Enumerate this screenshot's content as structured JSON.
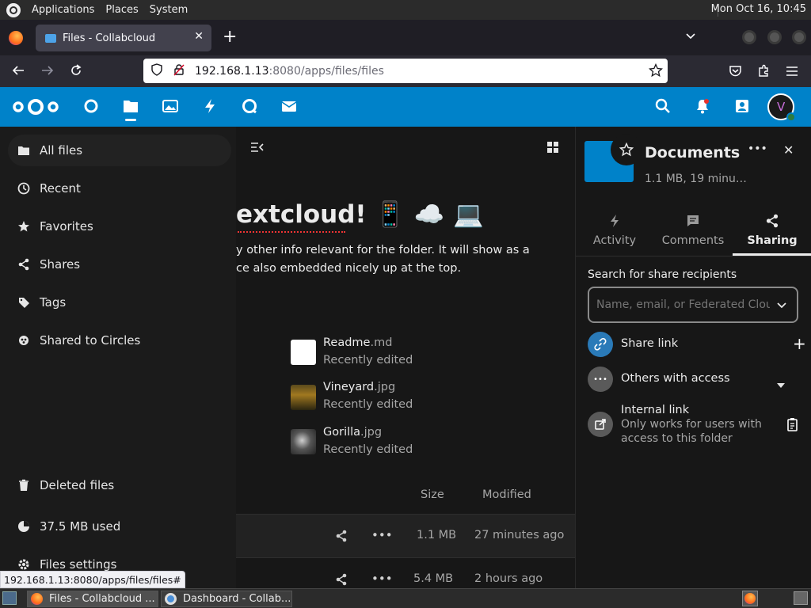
{
  "system": {
    "menu": [
      "Applications",
      "Places",
      "System"
    ],
    "clock": "Mon Oct 16, 10:45"
  },
  "browser": {
    "tab_title": "Files - Collabcloud",
    "url_host": "192.168.1.13",
    "url_rest": ":8080/apps/files/files",
    "status_url": "192.168.1.13:8080/apps/files/files#"
  },
  "nav": {
    "items": [
      "All files",
      "Recent",
      "Favorites",
      "Shares",
      "Tags",
      "Shared to Circles"
    ],
    "deleted": "Deleted files",
    "quota": "37.5 MB used",
    "settings": "Files settings"
  },
  "main": {
    "heading": "extcloud! 📱 ☁️ 💻",
    "para1": "y other info relevant for the folder. It will show as a",
    "para2": "ce also embedded nicely up at the top.",
    "recent": [
      {
        "name": "Readme",
        "ext": ".md",
        "sub": "Recently edited"
      },
      {
        "name": "Vineyard",
        "ext": ".jpg",
        "sub": "Recently edited"
      },
      {
        "name": "Gorilla",
        "ext": ".jpg",
        "sub": "Recently edited"
      }
    ],
    "col_size": "Size",
    "col_modified": "Modified",
    "rows": [
      {
        "size": "1.1 MB",
        "modified": "27 minutes ago"
      },
      {
        "size": "5.4 MB",
        "modified": "2 hours ago"
      }
    ]
  },
  "sidebar": {
    "title": "Documents",
    "subtitle": "1.1 MB, 19 minu…",
    "tabs": [
      "Activity",
      "Comments",
      "Sharing"
    ],
    "search_label": "Search for share recipients",
    "search_placeholder": "Name, email, or Federated Cloud ID …",
    "share_link": "Share link",
    "others_access": "Others with access",
    "internal_link": "Internal link",
    "internal_desc1": "Only works for users with",
    "internal_desc2": "access to this folder"
  },
  "taskbar": {
    "task1": "Files - Collabcloud ...",
    "task2": "Dashboard - Collab..."
  },
  "colors": {
    "brand": "#0082c9",
    "accent": "#2a7ab8"
  }
}
